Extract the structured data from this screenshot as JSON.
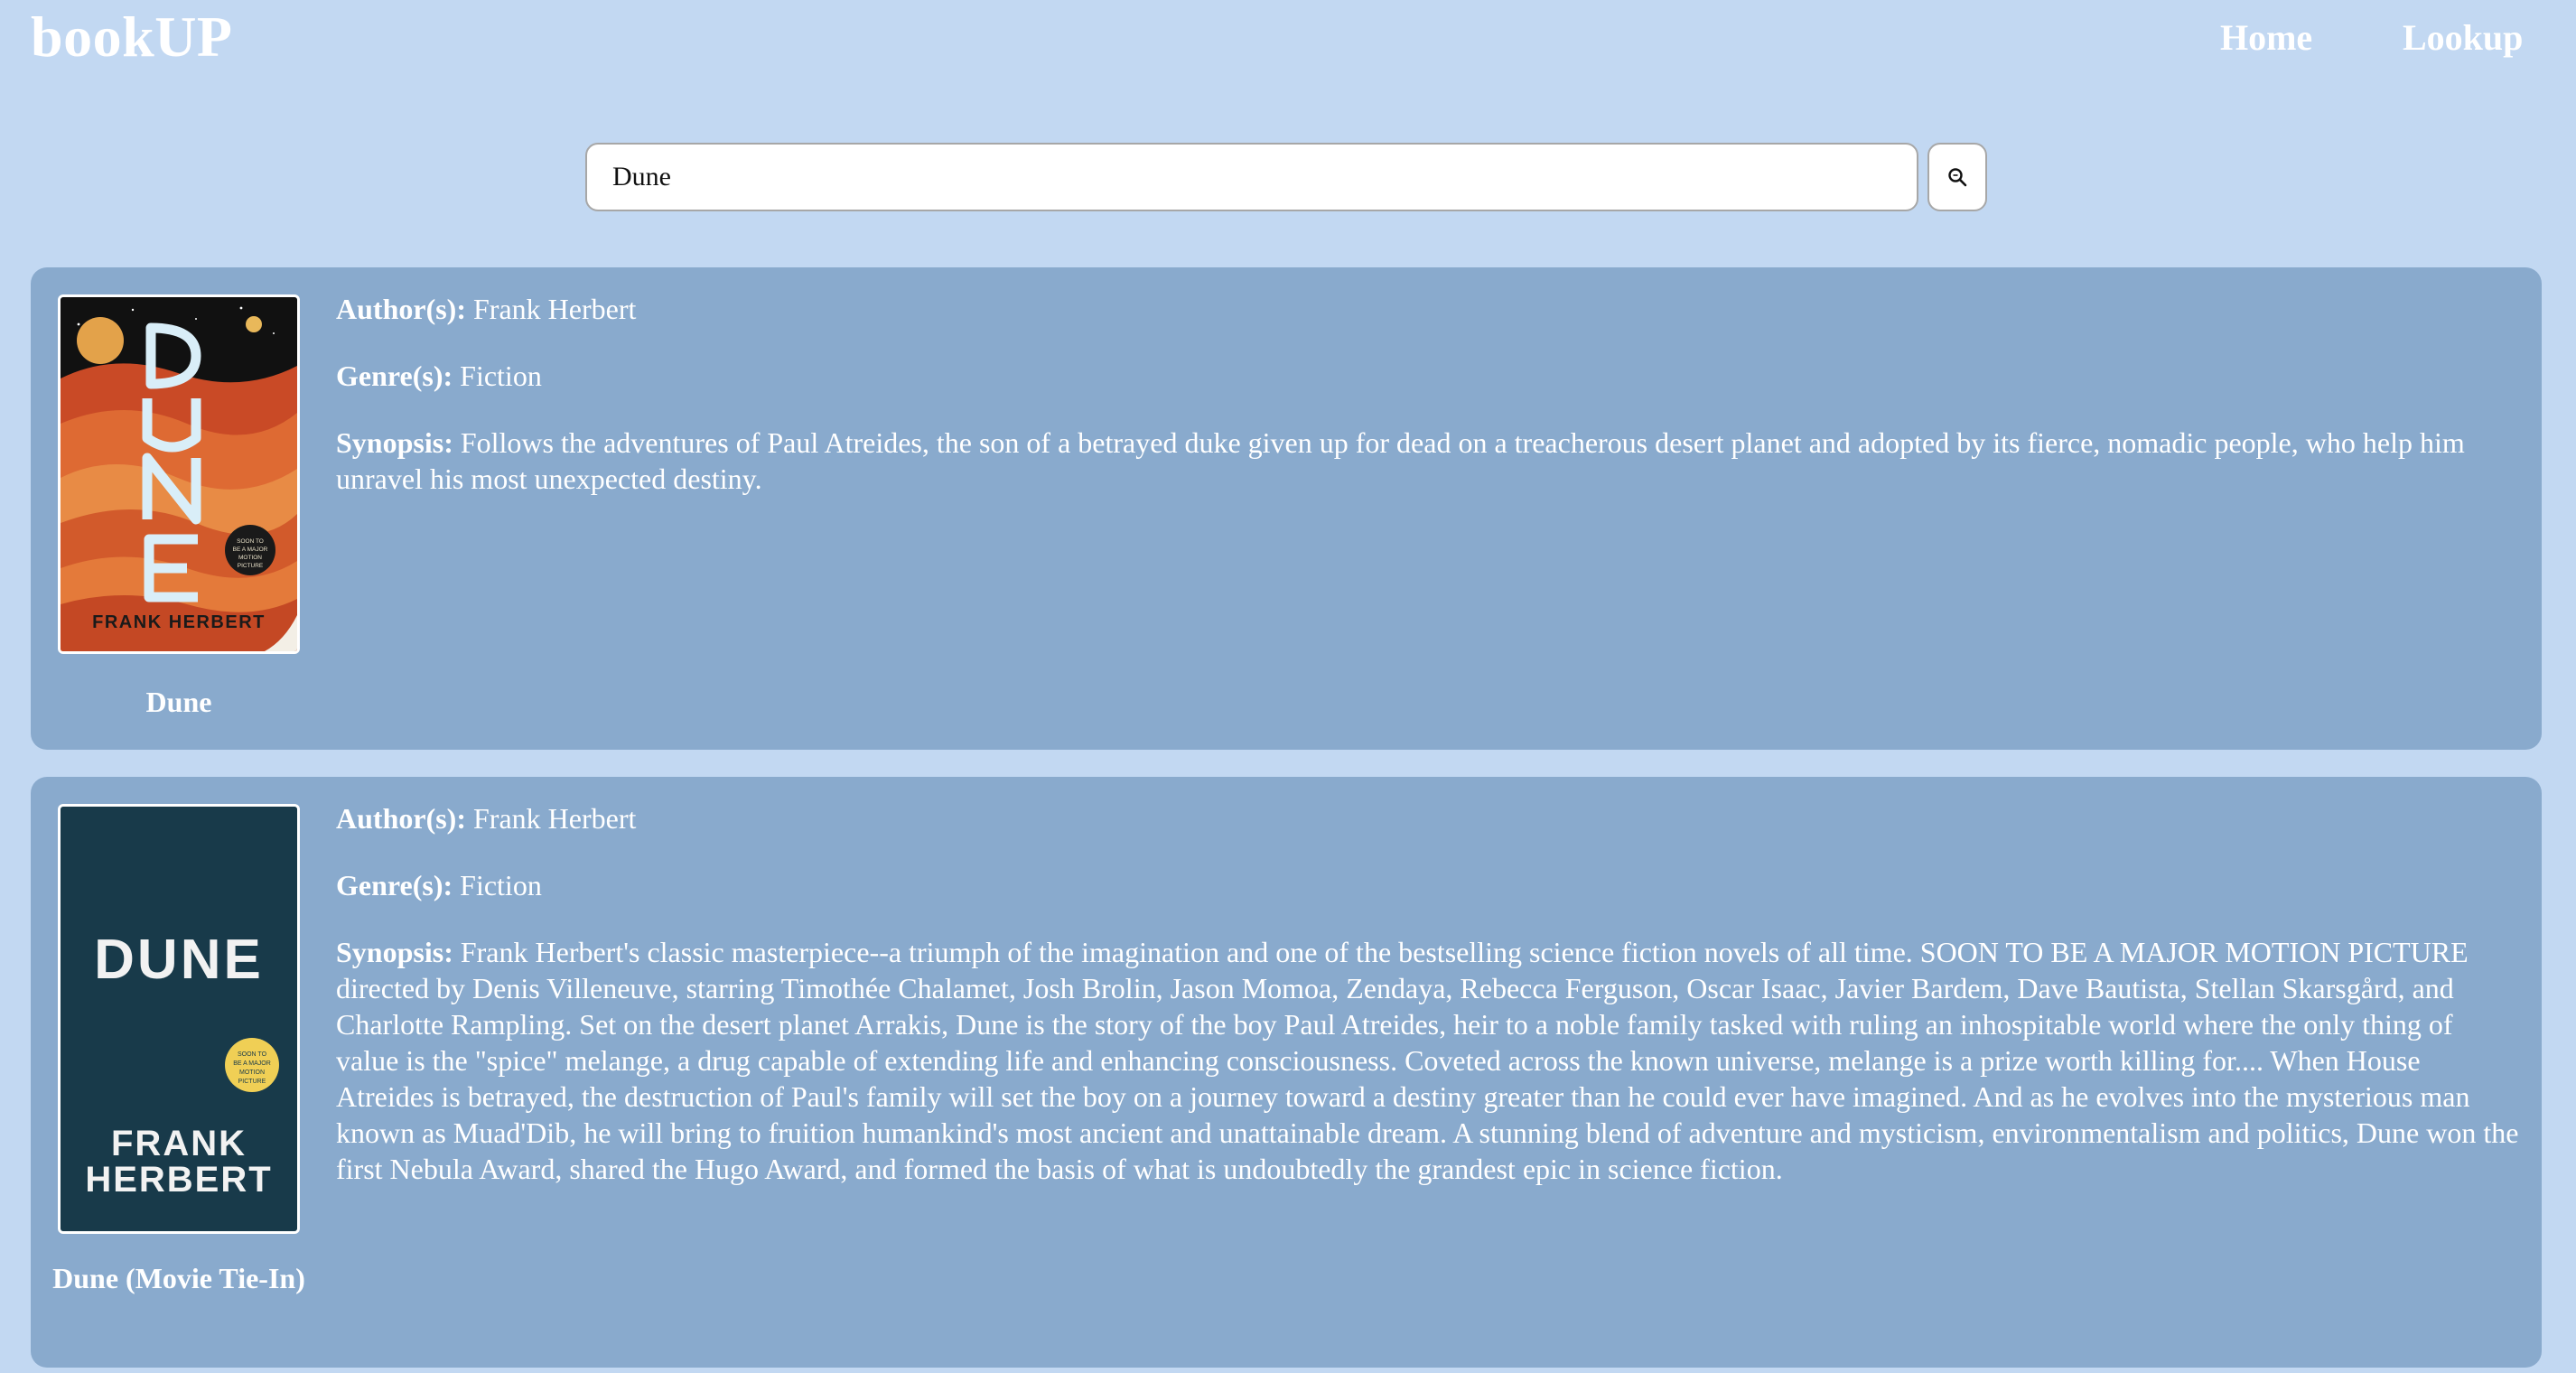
{
  "brand": "bookUP",
  "nav": {
    "home": "Home",
    "lookup": "Lookup"
  },
  "search": {
    "value": "Dune",
    "button_icon": "search-icon"
  },
  "labels": {
    "author": "Author(s):",
    "genre": "Genre(s):",
    "synopsis": "Synopsis:"
  },
  "results": [
    {
      "title": "Dune",
      "author": "Frank Herbert",
      "genre": "Fiction",
      "synopsis": "Follows the adventures of Paul Atreides, the son of a betrayed duke given up for dead on a treacherous desert planet and adopted by its fierce, nomadic people, who help him unravel his most unexpected destiny.",
      "cover": {
        "title_text": "DUNE",
        "author_text": "FRANK HERBERT",
        "badge_text": "SOON TO BE A MAJOR MOTION PICTURE"
      }
    },
    {
      "title": "Dune (Movie Tie-In)",
      "author": "Frank Herbert",
      "genre": "Fiction",
      "synopsis": "Frank Herbert's classic masterpiece--a triumph of the imagination and one of the bestselling science fiction novels of all time. SOON TO BE A MAJOR MOTION PICTURE directed by Denis Villeneuve, starring Timothée Chalamet, Josh Brolin, Jason Momoa, Zendaya, Rebecca Ferguson, Oscar Isaac, Javier Bardem, Dave Bautista, Stellan Skarsgård, and Charlotte Rampling. Set on the desert planet Arrakis, Dune is the story of the boy Paul Atreides, heir to a noble family tasked with ruling an inhospitable world where the only thing of value is the \"spice\" melange, a drug capable of extending life and enhancing consciousness. Coveted across the known universe, melange is a prize worth killing for.... When House Atreides is betrayed, the destruction of Paul's family will set the boy on a journey toward a destiny greater than he could ever have imagined. And as he evolves into the mysterious man known as Muad'Dib, he will bring to fruition humankind's most ancient and unattainable dream. A stunning blend of adventure and mysticism, environmentalism and politics, Dune won the first Nebula Award, shared the Hugo Award, and formed the basis of what is undoubtedly the grandest epic in science fiction.",
      "cover": {
        "title_text": "DUNE",
        "author_line1": "FRANK",
        "author_line2": "HERBERT",
        "badge_text": "SOON TO BE A MAJOR MOTION PICTURE"
      }
    }
  ],
  "colors": {
    "page_background": "#c2d8f2",
    "card_background": "#89aacd",
    "text": "#ffffff"
  }
}
